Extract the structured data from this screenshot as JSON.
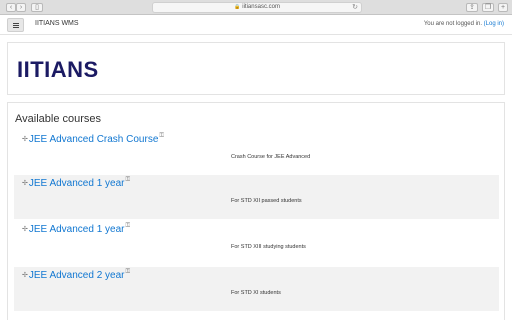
{
  "browser": {
    "url": "iitiansasc.com"
  },
  "navbar": {
    "site_name": "IITIANS WMS",
    "login_text": "You are not logged in. ",
    "login_link": "(Log in)"
  },
  "header": {
    "brand": "IITIANS"
  },
  "courses": {
    "title": "Available courses",
    "items": [
      {
        "name": "JEE Advanced Crash Course",
        "summary": "Crash Course for JEE Advanced"
      },
      {
        "name": "JEE Advanced 1 year",
        "summary": "For STD XII passed students"
      },
      {
        "name": "JEE Advanced 1 year",
        "summary": "For STD XIII studying students"
      },
      {
        "name": "JEE Advanced 2 year",
        "summary": "For STD XI students"
      }
    ]
  },
  "icons": {
    "course": "course-icon",
    "guest_access": "guest-access-icon",
    "menu": "hamburger-menu-icon",
    "lock": "lock-icon",
    "reload": "reload-icon"
  }
}
